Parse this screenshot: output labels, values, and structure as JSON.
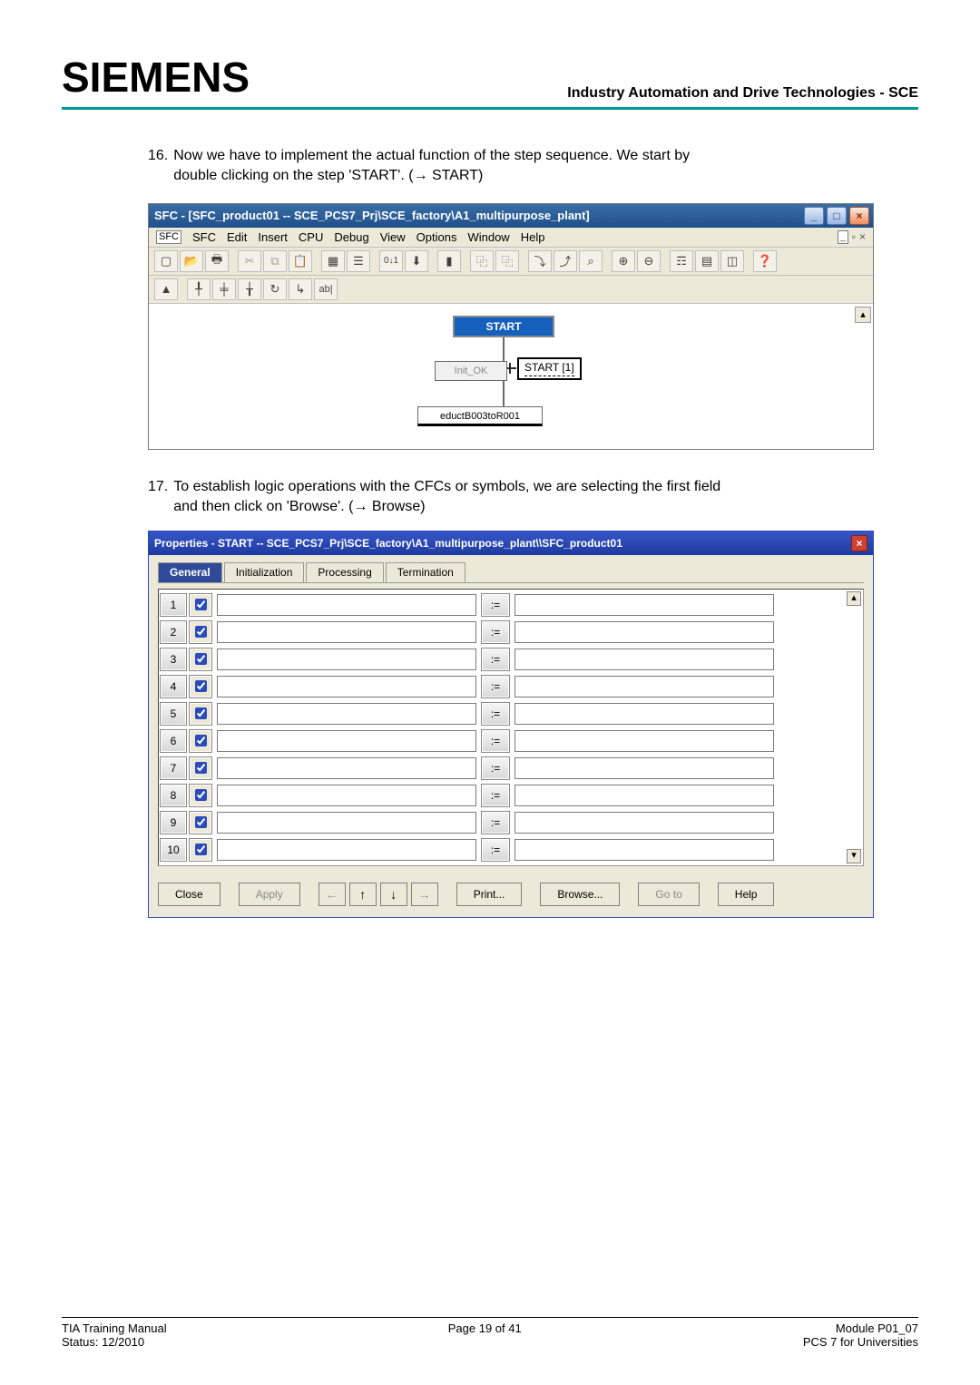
{
  "header": {
    "brand": "SIEMENS",
    "tagline": "Industry Automation and Drive Technologies - SCE"
  },
  "steps": {
    "s16": {
      "num": "16.",
      "text_a": "Now we have to implement the actual function of the step sequence. We start by",
      "text_b": "double clicking on the step 'START'. (",
      "arrow": "→",
      "text_c": " START)"
    },
    "s17": {
      "num": "17.",
      "text_a": "To establish logic operations with the CFCs or symbols, we are selecting the first field",
      "text_b": "and then click on 'Browse'. (",
      "arrow": "→",
      "text_c": " Browse)"
    }
  },
  "sfc_window": {
    "title": "SFC - [SFC_product01 -- SCE_PCS7_Prj\\SCE_factory\\A1_multipurpose_plant]",
    "menu": {
      "icon": "SFC",
      "items": [
        "SFC",
        "Edit",
        "Insert",
        "CPU",
        "Debug",
        "View",
        "Options",
        "Window",
        "Help"
      ]
    },
    "nodes": {
      "start": "START",
      "init": "Init_OK",
      "start1": "START [1]",
      "educt": "eductB003toR001"
    }
  },
  "dlg": {
    "title": "Properties -  START -- SCE_PCS7_Prj\\SCE_factory\\A1_multipurpose_plant\\\\SFC_product01",
    "tabs": [
      "General",
      "Initialization",
      "Processing",
      "Termination"
    ],
    "rows": [
      1,
      2,
      3,
      4,
      5,
      6,
      7,
      8,
      9,
      10
    ],
    "assign": ":=",
    "buttons": {
      "close": "Close",
      "apply": "Apply",
      "print": "Print...",
      "browse": "Browse...",
      "goto": "Go to",
      "help": "Help"
    }
  },
  "footer": {
    "left1": "TIA Training Manual",
    "left2": "Status: 12/2010",
    "center": "Page 19 of 41",
    "right1": "Module P01_07",
    "right2": "PCS 7 for Universities"
  }
}
